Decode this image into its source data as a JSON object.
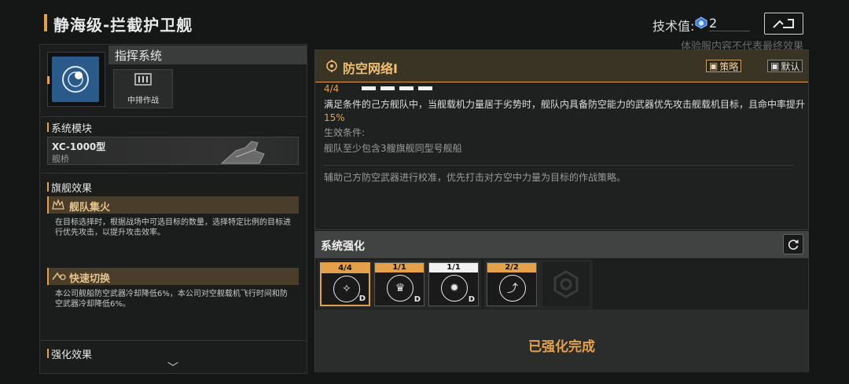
{
  "header": {
    "title": "静海级-拦截护卫舰",
    "tech_label": "技术值:",
    "tech_value": "2",
    "notice": "体验服内容不代表最终效果",
    "back_icon": "back-icon"
  },
  "left": {
    "command": {
      "title": "指挥系统",
      "slot_label": "中排作战"
    },
    "module_section": {
      "label": "系统模块",
      "name": "XC-1000型",
      "sub": "舰桥"
    },
    "flagship_section": {
      "label": "旗舰效果",
      "skills": [
        {
          "name": "舰队集火",
          "desc": "在目标选择时，根据战场中可选目标的数量，选择特定比例的目标进行优先攻击，以提升攻击效率。"
        },
        {
          "name": "快速切换",
          "desc": "本公司舰船防空武器冷却降低6%，本公司对空舰载机飞行时间和防空武器冷却降低6%。"
        }
      ]
    },
    "enhance_section": {
      "label": "强化效果"
    }
  },
  "right": {
    "ability": {
      "title": "防空网络Ⅰ",
      "tag_strategy": "策略",
      "tag_default": "默认",
      "level": "4/4",
      "desc_main": "满足条件的己方舰队中，当舰载机力量居于劣势时，舰队内具备防空能力的武器优先攻击舰载机目标，且命中率提升",
      "desc_highlight": "15%",
      "cond_label": "生效条件:",
      "cond_text": "舰队至少包含3艘旗舰同型号舰船",
      "flavor": "辅助己方防空武器进行校准，优先打击对方空中力量为目标的作战策略。"
    },
    "enhancement": {
      "title": "系统强化",
      "slots": [
        {
          "level": "4/4",
          "badge": "D",
          "header_color": "#e4a14a"
        },
        {
          "level": "1/1",
          "badge": "D",
          "header_color": "#e4a14a"
        },
        {
          "level": "1/1",
          "badge": "D",
          "header_color": "#f2f2f2"
        },
        {
          "level": "2/2",
          "badge": "",
          "header_color": "#e4a14a"
        }
      ],
      "done_text": "已强化完成"
    }
  }
}
